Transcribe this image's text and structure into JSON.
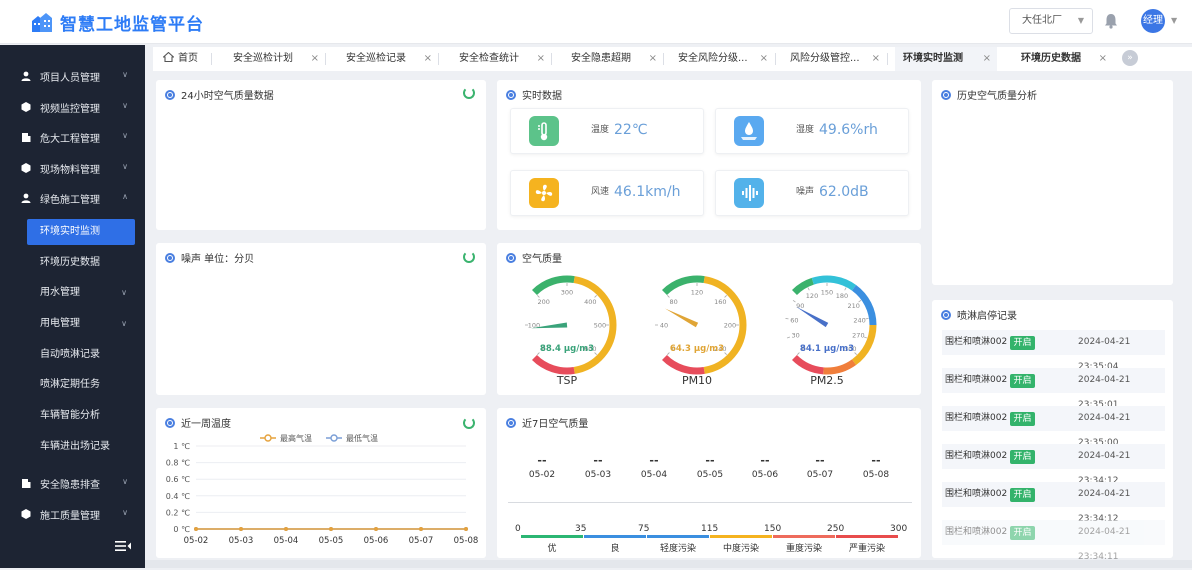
{
  "app": {
    "title": "智慧工地监管平台"
  },
  "header": {
    "site": "大任北厂",
    "user": "经理"
  },
  "sidebar": {
    "items": [
      {
        "label": "项目人员管理"
      },
      {
        "label": "视频监控管理"
      },
      {
        "label": "危大工程管理"
      },
      {
        "label": "现场物料管理"
      },
      {
        "label": "绿色施工管理"
      },
      {
        "label": "安全隐患排查"
      },
      {
        "label": "施工质量管理"
      }
    ],
    "sub": [
      {
        "label": "环境实时监测"
      },
      {
        "label": "环境历史数据"
      },
      {
        "label": "用水管理"
      },
      {
        "label": "用电管理"
      },
      {
        "label": "自动喷淋记录"
      },
      {
        "label": "喷淋定期任务"
      },
      {
        "label": "车辆智能分析"
      },
      {
        "label": "车辆进出场记录"
      }
    ]
  },
  "tabs": [
    {
      "label": "首页"
    },
    {
      "label": "安全巡检计划"
    },
    {
      "label": "安全巡检记录"
    },
    {
      "label": "安全检查统计"
    },
    {
      "label": "安全隐患超期"
    },
    {
      "label": "安全风险分级..."
    },
    {
      "label": "风险分级管控..."
    },
    {
      "label": "环境实时监测"
    },
    {
      "label": "环境历史数据"
    }
  ],
  "panels": {
    "air24": {
      "title": "24小时空气质量数据"
    },
    "realtime": {
      "title": "实时数据"
    },
    "history": {
      "title": "历史空气质量分析"
    },
    "noise": {
      "title": "噪声 单位：分贝"
    },
    "airq": {
      "title": "空气质量"
    },
    "spray": {
      "title": "喷淋启停记录"
    },
    "week_temp": {
      "title": "近一周温度"
    },
    "week_aq": {
      "title": "近7日空气质量"
    }
  },
  "realtime": [
    {
      "label": "温度",
      "value": "22℃",
      "icon": "thermometer-icon",
      "color": "#5cc38a"
    },
    {
      "label": "湿度",
      "value": "49.6%rh",
      "icon": "humidity-icon",
      "color": "#5aa9f0"
    },
    {
      "label": "风速",
      "value": "46.1km/h",
      "icon": "fan-icon",
      "color": "#f5b31f"
    },
    {
      "label": "噪声",
      "value": "62.0dB",
      "icon": "soundwave-icon",
      "color": "#53b2ea"
    }
  ],
  "gauges": [
    {
      "name": "TSP",
      "value": 88.4,
      "reading": "88.4 μg/m3",
      "max": 600,
      "ticks": [
        "0",
        "100",
        "200",
        "300",
        "400",
        "500",
        "600"
      ]
    },
    {
      "name": "PM10",
      "value": 64.3,
      "reading": "64.3 μg/m3",
      "max": 240,
      "ticks": [
        "0",
        "40",
        "80",
        "120",
        "160",
        "200",
        "240"
      ]
    },
    {
      "name": "PM2.5",
      "value": 84.1,
      "reading": "84.1 μg/m3",
      "max": 300,
      "ticks": [
        "0",
        "30",
        "60",
        "90",
        "120",
        "150",
        "180",
        "210",
        "240",
        "270",
        "300"
      ]
    }
  ],
  "spray": {
    "rows": [
      {
        "name": "围栏和喷淋002",
        "status": "开启",
        "time": "2024-04-21 23:35:04"
      },
      {
        "name": "围栏和喷淋002",
        "status": "开启",
        "time": "2024-04-21 23:35:01"
      },
      {
        "name": "围栏和喷淋002",
        "status": "开启",
        "time": "2024-04-21 23:35:00"
      },
      {
        "name": "围栏和喷淋002",
        "status": "开启",
        "time": "2024-04-21 23:34:12"
      },
      {
        "name": "围栏和喷淋002",
        "status": "开启",
        "time": "2024-04-21 23:34:12"
      },
      {
        "name": "围栏和喷淋002",
        "status": "开启",
        "time": "2024-04-21 23:34:11"
      }
    ]
  },
  "week_aq": {
    "dates": [
      "05-02",
      "05-03",
      "05-04",
      "05-05",
      "05-06",
      "05-07",
      "05-08"
    ],
    "values": [
      "--",
      "--",
      "--",
      "--",
      "--",
      "--",
      "--"
    ],
    "levels": [
      {
        "name": "优",
        "from": "0",
        "to": "35",
        "color": "#2bb673"
      },
      {
        "name": "良",
        "from": "35",
        "to": "75",
        "color": "#3b8fe0"
      },
      {
        "name": "轻度污染",
        "from": "75",
        "to": "115",
        "color": "#3b8fe0"
      },
      {
        "name": "中度污染",
        "from": "115",
        "to": "150",
        "color": "#f5b31f"
      },
      {
        "name": "重度污染",
        "from": "150",
        "to": "250",
        "color": "#ee6b5c"
      },
      {
        "name": "严重污染",
        "from": "250",
        "to": "300",
        "color": "#e84c4c"
      }
    ]
  },
  "chart_data": {
    "type": "line",
    "categories": [
      "05-02",
      "05-03",
      "05-04",
      "05-05",
      "05-06",
      "05-07",
      "05-08"
    ],
    "series": [
      {
        "name": "最高气温",
        "values": [
          0,
          0,
          0,
          0,
          0,
          0,
          0
        ],
        "color": "#e6a23c"
      },
      {
        "name": "最低气温",
        "values": [
          0,
          0,
          0,
          0,
          0,
          0,
          0
        ],
        "color": "#7a9ed6"
      }
    ],
    "yticks": [
      "0 ℃",
      "0.2 ℃",
      "0.4 ℃",
      "0.6 ℃",
      "0.8 ℃",
      "1 ℃"
    ],
    "ylim": [
      0,
      1
    ]
  }
}
